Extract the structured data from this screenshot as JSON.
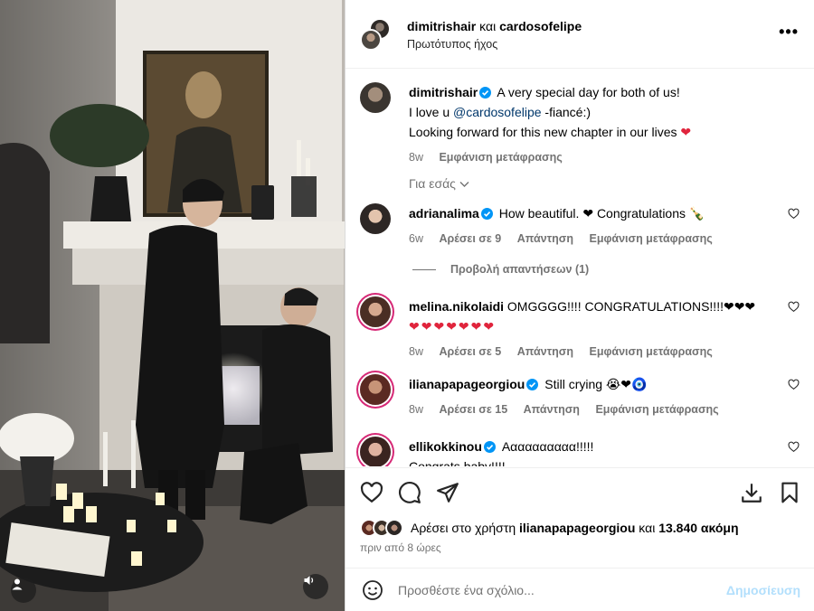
{
  "header": {
    "user1": "dimitrishair",
    "connector": "και",
    "user2": "cardosofelipe",
    "audio": "Πρωτότυπος ήχος",
    "more": "•••"
  },
  "caption": {
    "username": "dimitrishair",
    "line1": "A very special day for both of us!",
    "line2_prefix": "I love u ",
    "mention": "@cardosofelipe",
    "line2_suffix": " -fiancé:)",
    "line3": "Looking forward for this new chapter in our lives",
    "emoji": "❤",
    "time": "8w",
    "translate": "Εμφάνιση μετάφρασης"
  },
  "for_you": "Για εσάς",
  "comments": [
    {
      "username": "adrianalima",
      "verified": true,
      "text": "How beautiful. ❤ Congratulations 🍾",
      "time": "6w",
      "likes": "Αρέσει σε 9",
      "reply": "Απάντηση",
      "translate": "Εμφάνιση μετάφρασης",
      "replies": "Προβολή απαντήσεων (1)"
    },
    {
      "username": "melina.nikolaidi",
      "verified": false,
      "text": "OMGGGG!!!! CONGRATULATIONS!!!!❤❤❤",
      "text2": "❤❤❤❤❤❤❤",
      "time": "8w",
      "likes": "Αρέσει σε 5",
      "reply": "Απάντηση",
      "translate": "Εμφάνιση μετάφρασης"
    },
    {
      "username": "ilianapapageorgiou",
      "verified": true,
      "text": "Still crying 😭❤🧿",
      "time": "8w",
      "likes": "Αρέσει σε 15",
      "reply": "Απάντηση",
      "translate": "Εμφάνιση μετάφρασης"
    },
    {
      "username": "ellikokkinou",
      "verified": true,
      "text": "Αααααααααα!!!!!",
      "text2": "Congrats baby!!!!"
    }
  ],
  "likes": {
    "prefix": "Αρέσει στο χρήστη ",
    "user": "ilianapapageorgiou",
    "middle": " και ",
    "count": "13.840 ακόμη"
  },
  "time_ago": "πριν από 8 ώρες",
  "add_comment": {
    "placeholder": "Προσθέστε ένα σχόλιο...",
    "post": "Δημοσίευση"
  },
  "colors": {
    "heart": "#e0243c",
    "verified": "#0095f6",
    "story_ring": "#d62976",
    "post_disabled": "#b2dffc"
  },
  "icons": [
    "heart-icon",
    "comment-icon",
    "share-icon",
    "download-icon",
    "bookmark-icon",
    "emoji-icon",
    "user-tag-icon",
    "speaker-icon",
    "more-icon",
    "verified-icon"
  ]
}
